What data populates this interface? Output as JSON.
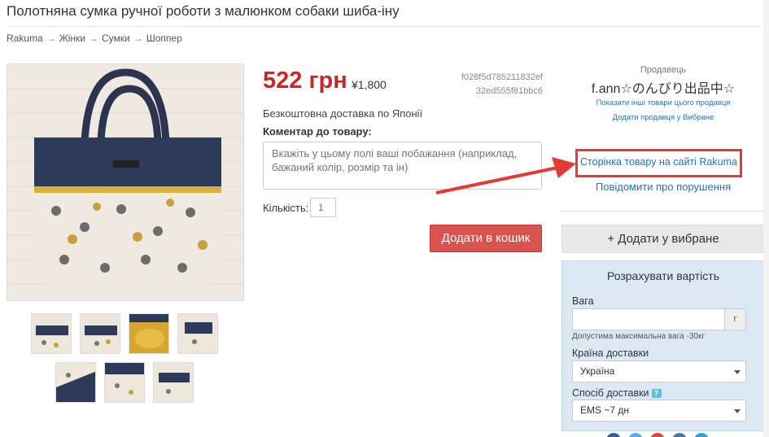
{
  "product": {
    "title": "Полотняна сумка ручної роботи з малюнком собаки шиба-іну",
    "price": "522 грн",
    "price_yen": "¥1,800",
    "code_line1": "f028f5d785211832ef",
    "code_line2": "32ed555f81bbc6",
    "shipping": "Безкоштовна доставка по Японії",
    "comment_label": "Коментар до товару:",
    "comment_placeholder": "Вкажіть у цьому полі ваші побажання (наприклад, бажаний колір, розмір та ін)",
    "qty_label": "Кількість:",
    "qty_value": "1",
    "cart_button": "Додати в кошик"
  },
  "breadcrumb": [
    "Rakuma",
    "Жінки",
    "Сумки",
    "Шоппер"
  ],
  "breadcrumb_sep": "→",
  "seller": {
    "label": "Продавець",
    "name": "f.ann☆のんびり出品中☆",
    "link_other": "Показати інші товари цього продавця",
    "link_favorite": "Додати продавця у Вибране",
    "rakuma_link": "Сторінка товару на сайті Rakuma",
    "report_link": "Повідомити про порушення"
  },
  "favorite_button": "+ Додати у вибране",
  "calc": {
    "title": "Розрахувати вартість",
    "weight_label": "Вага",
    "weight_value": "",
    "weight_unit": "г",
    "weight_hint": "Допустима максимальна вага -30кг",
    "country_label": "Країна доставки",
    "country_value": "Україна",
    "method_label": "Спосіб доставки",
    "method_help": "?",
    "method_value": "EMS ~7 дн"
  },
  "colors": {
    "price": "#c62828",
    "cart_button": "#d9534f",
    "link": "#2a6fb5",
    "highlight": "#e53935",
    "calc_panel": "#dce9f5"
  }
}
